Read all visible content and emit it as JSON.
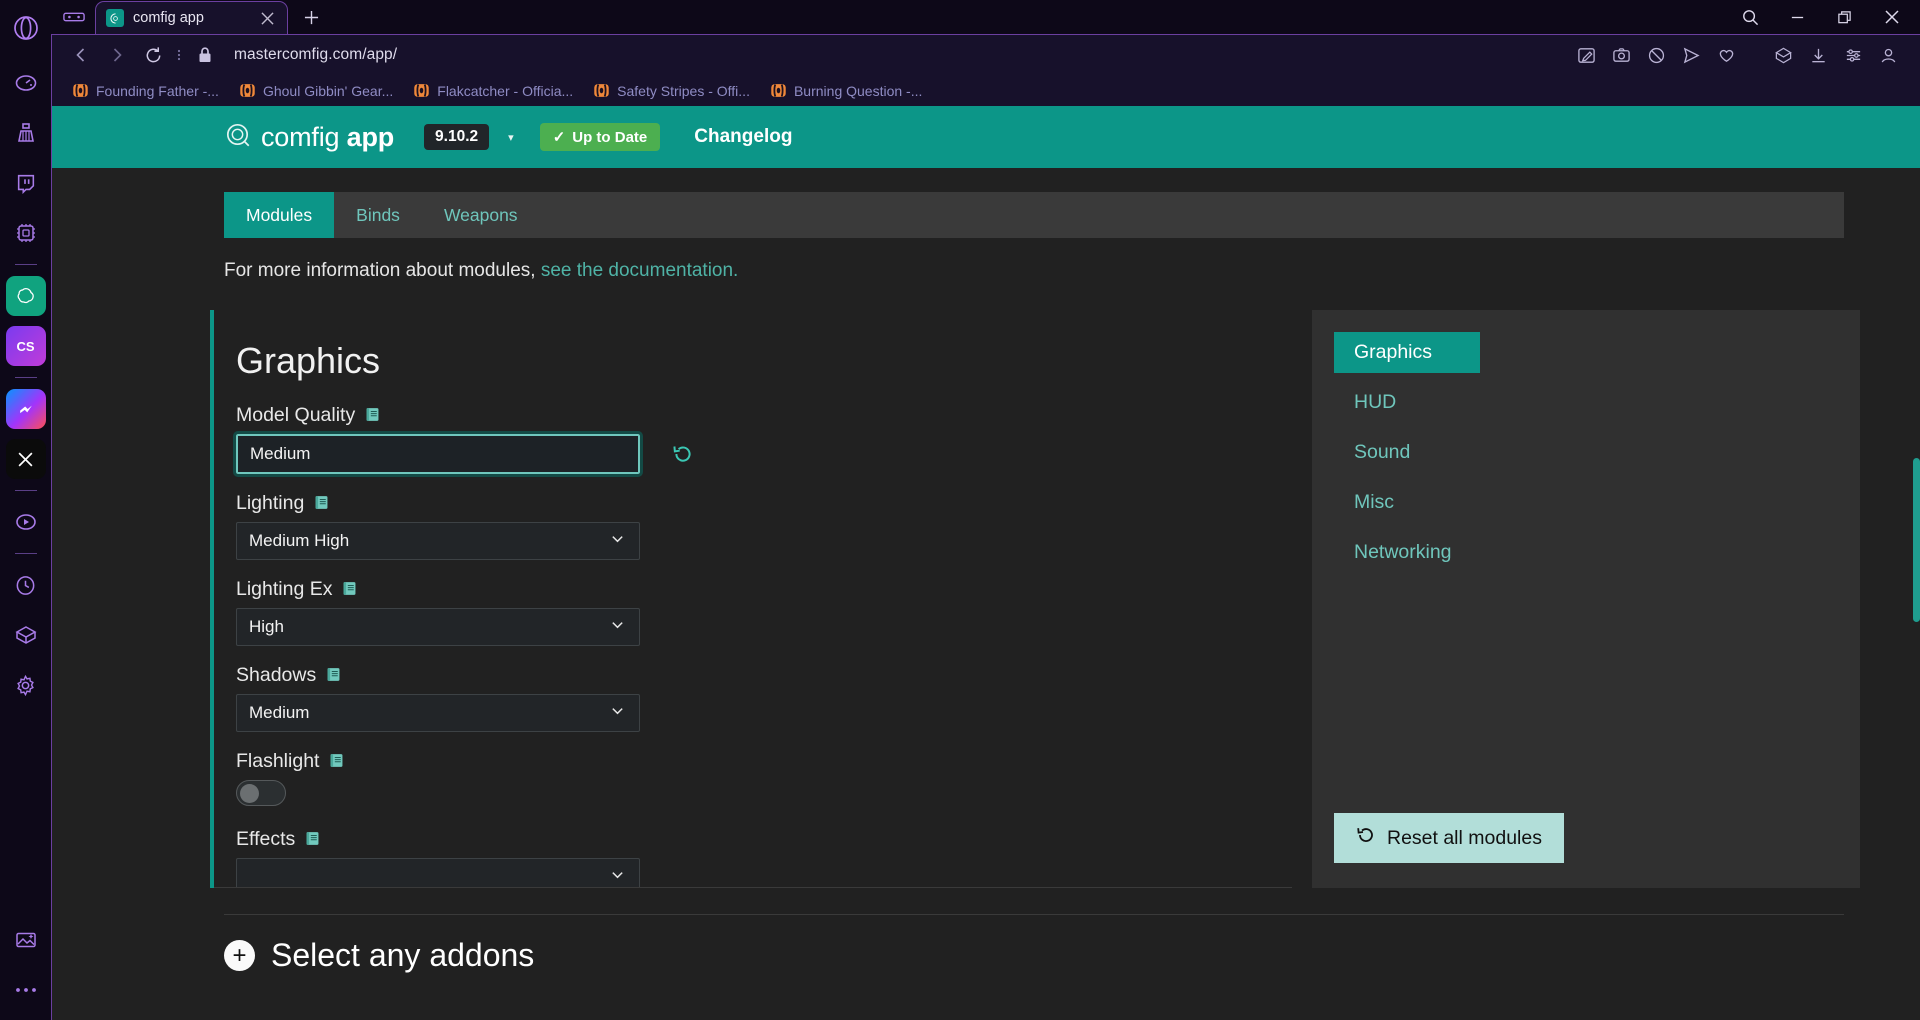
{
  "browser": {
    "name": "opera",
    "tab": {
      "title": "comfig app",
      "favicon": "comfig-logo-icon"
    },
    "new_tab_label": "+",
    "address": "mastercomfig.com/app/",
    "lock_icon": "lock-icon",
    "nav": {
      "back": "back-icon",
      "forward": "forward-icon",
      "reload": "reload-icon"
    },
    "address_icons": [
      "edit-note-icon",
      "screenshot-icon",
      "ad-block-icon",
      "send-icon",
      "heart-icon",
      "cube-icon",
      "download-icon",
      "sliders-icon",
      "profile-icon"
    ],
    "window_controls": [
      "search-icon",
      "minimize-icon",
      "restore-icon",
      "close-icon"
    ],
    "bookmarks": [
      {
        "label": "Founding Father -...",
        "icon": "tf2-icon"
      },
      {
        "label": "Ghoul Gibbin' Gear...",
        "icon": "tf2-icon"
      },
      {
        "label": "Flakcatcher - Officia...",
        "icon": "tf2-icon"
      },
      {
        "label": "Safety Stripes - Offi...",
        "icon": "tf2-icon"
      },
      {
        "label": "Burning Question -...",
        "icon": "tf2-icon"
      }
    ],
    "sidebar_rail": [
      {
        "name": "opera-logo-icon"
      },
      {
        "name": "speed-dial-icon"
      },
      {
        "name": "cleaner-icon"
      },
      {
        "name": "twitch-icon"
      },
      {
        "name": "aria-chip-icon"
      },
      {
        "name": "separator"
      },
      {
        "name": "chatgpt-icon"
      },
      {
        "name": "cs-icon"
      },
      {
        "name": "separator"
      },
      {
        "name": "messenger-icon"
      },
      {
        "name": "x-twitter-icon"
      },
      {
        "name": "separator"
      },
      {
        "name": "player-icon"
      },
      {
        "name": "separator"
      },
      {
        "name": "history-icon"
      },
      {
        "name": "box-icon"
      },
      {
        "name": "settings-gear-icon"
      },
      {
        "name": "gallery-icon"
      },
      {
        "name": "more-icon"
      }
    ]
  },
  "site": {
    "header": {
      "logo_icon": "comfig-logo-icon",
      "brand_light": "comfig",
      "brand_bold": "app",
      "version": "9.10.2",
      "version_caret": "▾",
      "status_badge": {
        "label": "Up to Date",
        "check": "✓"
      },
      "changelog": "Changelog",
      "accent_color": "#0c9688",
      "status_color": "#4caf50"
    },
    "tabs": [
      {
        "label": "Modules",
        "active": true
      },
      {
        "label": "Binds",
        "active": false
      },
      {
        "label": "Weapons",
        "active": false
      }
    ],
    "doc_note": {
      "text": "For more information about modules, ",
      "link": "see the documentation.",
      "link_color": "#4fb3a6"
    },
    "settings": {
      "title": "Graphics",
      "fields": [
        {
          "label": "Model Quality",
          "icon": "book-icon",
          "type": "select",
          "value": "Medium",
          "focused": true,
          "has_reset": true
        },
        {
          "label": "Lighting",
          "icon": "book-icon",
          "type": "select",
          "value": "Medium High",
          "focused": false,
          "has_reset": false
        },
        {
          "label": "Lighting Ex",
          "icon": "book-icon",
          "type": "select",
          "value": "High",
          "focused": false,
          "has_reset": false
        },
        {
          "label": "Shadows",
          "icon": "book-icon",
          "type": "select",
          "value": "Medium",
          "focused": false,
          "has_reset": false
        },
        {
          "label": "Flashlight",
          "icon": "book-icon",
          "type": "toggle",
          "value": "off",
          "focused": false,
          "has_reset": false
        },
        {
          "label": "Effects",
          "icon": "book-icon",
          "type": "select",
          "value": "",
          "focused": false,
          "has_reset": false
        }
      ]
    },
    "side_nav": {
      "items": [
        {
          "label": "Graphics",
          "active": true
        },
        {
          "label": "HUD",
          "active": false
        },
        {
          "label": "Sound",
          "active": false
        },
        {
          "label": "Misc",
          "active": false
        },
        {
          "label": "Networking",
          "active": false
        }
      ],
      "reset_all": {
        "label": "Reset all modules",
        "icon": "reset-icon",
        "bg": "#b2ded9"
      }
    },
    "addons": {
      "title": "Select any addons",
      "plus": "+"
    }
  }
}
